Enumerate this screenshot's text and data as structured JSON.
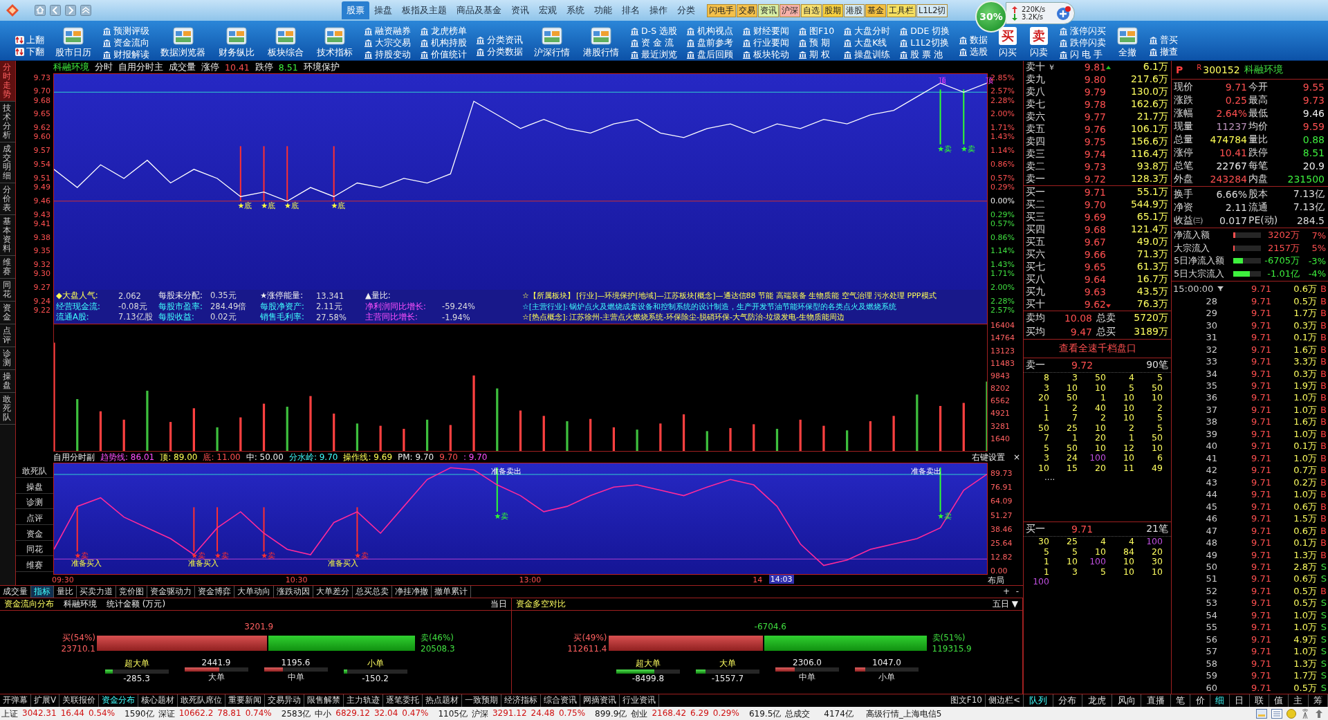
{
  "top_bar": {
    "menu": [
      {
        "label": "股票",
        "selected": true
      },
      {
        "label": "操盘",
        "selected": false
      },
      {
        "label": "板指及主题",
        "selected": false
      },
      {
        "label": "商品及基金",
        "selected": false
      },
      {
        "label": "资讯",
        "selected": false
      },
      {
        "label": "宏观",
        "selected": false
      },
      {
        "label": "系统",
        "selected": false
      },
      {
        "label": "功能",
        "selected": false
      },
      {
        "label": "排名",
        "selected": false
      },
      {
        "label": "操作",
        "selected": false
      },
      {
        "label": "分类",
        "selected": false
      }
    ],
    "tags": [
      {
        "label": "闪电手",
        "color": "#f4c04a"
      },
      {
        "label": "交易",
        "color": "#f4c04a"
      },
      {
        "label": "资讯",
        "color": "#d6eea4"
      },
      {
        "label": "沪深",
        "color": "#f6b0a8"
      },
      {
        "label": "自选",
        "color": "#f6e070"
      },
      {
        "label": "股期",
        "color": "#f6d040"
      },
      {
        "label": "港股",
        "color": "#d4e8f0"
      },
      {
        "label": "基金",
        "color": "#f4c040"
      },
      {
        "label": "工具栏",
        "color": "#f6e060"
      },
      {
        "label": "L1L2切",
        "color": "#d4e8f4"
      }
    ],
    "speed": {
      "percent": "30%",
      "up": "220K/s",
      "down": "3.2K/s"
    }
  },
  "toolbar": [
    {
      "kind": "pager",
      "items": [
        "上翻",
        "下翻"
      ]
    },
    {
      "kind": "big",
      "items": [
        "股市日历"
      ]
    },
    {
      "kind": "list",
      "items": [
        "预测评级",
        "资金流向",
        "财报解读"
      ]
    },
    {
      "kind": "big",
      "items": [
        "数据浏览器"
      ]
    },
    {
      "kind": "big",
      "items": [
        "财务纵比"
      ]
    },
    {
      "kind": "big",
      "items": [
        "板块综合"
      ]
    },
    {
      "kind": "big",
      "items": [
        "技术指标"
      ]
    },
    {
      "kind": "list",
      "items": [
        "融资融券",
        "大宗交易",
        "持股变动"
      ]
    },
    {
      "kind": "list",
      "items": [
        "龙虎榜单",
        "机构持股",
        "价值统计"
      ]
    },
    {
      "kind": "list",
      "items": [
        "分类资讯",
        "分类数据"
      ]
    },
    {
      "kind": "big",
      "items": [
        "沪深行情"
      ]
    },
    {
      "kind": "big",
      "items": [
        "港股行情"
      ]
    },
    {
      "kind": "list",
      "items": [
        "D-S 选股",
        "资 金 流",
        "最近浏览"
      ]
    },
    {
      "kind": "list",
      "items": [
        "机构视点",
        "盘前参考",
        "盘后回顾"
      ]
    },
    {
      "kind": "list",
      "items": [
        "财经要闻",
        "行业要闻",
        "板块轮动"
      ]
    },
    {
      "kind": "list",
      "items": [
        "图F10",
        "预 期",
        "期 权"
      ]
    },
    {
      "kind": "list",
      "items": [
        "大盘分时",
        "大盘K线",
        "操盘训练"
      ]
    },
    {
      "kind": "list",
      "items": [
        "DDE 切换",
        "L1L2切换",
        "股 票 池"
      ]
    },
    {
      "kind": "list",
      "items": [
        "数据",
        "选股"
      ]
    },
    {
      "kind": "big",
      "items": [
        "闪买"
      ],
      "badge": "买"
    },
    {
      "kind": "big",
      "items": [
        "闪卖"
      ],
      "badge": "卖"
    },
    {
      "kind": "list",
      "items": [
        "涨停闪买",
        "跌停闪卖",
        "闪 电 手"
      ]
    },
    {
      "kind": "big",
      "items": [
        "全撤"
      ]
    },
    {
      "kind": "list",
      "items": [
        "普买",
        "撤查"
      ]
    }
  ],
  "side_tabs": [
    {
      "label": "分时走势",
      "selected": true
    },
    {
      "label": "技术分析",
      "selected": false
    },
    {
      "label": "成交明细",
      "selected": false
    },
    {
      "label": "分价表",
      "selected": false
    },
    {
      "label": "基本资料",
      "selected": false
    },
    {
      "label": "维赛",
      "selected": false
    },
    {
      "label": "同花",
      "selected": false
    },
    {
      "label": "资金",
      "selected": false
    },
    {
      "label": "点评",
      "selected": false
    },
    {
      "label": "诊测",
      "selected": false
    },
    {
      "label": "操盘",
      "selected": false
    },
    {
      "label": "敢死队",
      "selected": false
    }
  ],
  "price_chart": {
    "header": [
      {
        "text": "科融环境",
        "kind": "stock"
      },
      {
        "text": "分时",
        "kind": "text"
      },
      {
        "text": "自用分时主",
        "kind": "text"
      },
      {
        "text": "成交量",
        "kind": "text"
      },
      {
        "text": "涨停",
        "kind": "text"
      },
      {
        "text": "10.41",
        "kind": "up"
      },
      {
        "text": "跌停",
        "kind": "text"
      },
      {
        "text": "8.51",
        "kind": "down"
      },
      {
        "text": "环境保护",
        "kind": "text"
      }
    ],
    "right_ticks": [
      "2.85%",
      "2.57%",
      "2.28%",
      "2.00%",
      "1.71%",
      "1.43%",
      "1.14%",
      "0.86%",
      "0.57%",
      "0.29%",
      "0.00%",
      "0.29%",
      "0.57%",
      "0.86%",
      "1.14%",
      "1.43%",
      "1.71%",
      "2.00%",
      "2.28%",
      "2.57%"
    ],
    "chart_data": {
      "type": "line",
      "ylim": [
        9.19,
        9.74
      ],
      "categories": [
        null,
        null,
        null,
        null,
        null,
        null,
        null,
        null,
        null,
        null,
        null,
        null,
        null,
        null,
        null,
        null,
        null,
        null,
        null,
        null,
        null,
        null,
        null,
        null,
        null,
        null,
        null,
        null,
        null,
        null,
        null,
        null,
        null,
        null,
        null,
        null,
        null,
        null,
        null,
        null,
        null
      ],
      "values": [
        9.53,
        9.49,
        9.54,
        9.51,
        9.55,
        9.5,
        9.53,
        9.51,
        9.47,
        9.48,
        9.46,
        9.49,
        9.47,
        9.5,
        9.49,
        9.51,
        9.5,
        9.52,
        9.68,
        9.65,
        9.62,
        9.64,
        9.62,
        9.61,
        9.63,
        9.64,
        9.61,
        9.6,
        9.62,
        9.63,
        9.61,
        9.63,
        9.62,
        9.64,
        9.63,
        9.65,
        9.66,
        9.69,
        9.72,
        9.7,
        9.72
      ],
      "yticks": [
        {
          "value": 9.73,
          "label": "9.73"
        },
        {
          "value": 9.7,
          "label": "9.70"
        },
        {
          "value": 9.68,
          "label": "9.68"
        },
        {
          "value": 9.65,
          "label": "9.65"
        },
        {
          "value": 9.62,
          "label": "9.62"
        },
        {
          "value": 9.6,
          "label": "9.60"
        },
        {
          "value": 9.57,
          "label": "9.57"
        },
        {
          "value": 9.54,
          "label": "9.54"
        },
        {
          "value": 9.51,
          "label": "9.51"
        },
        {
          "value": 9.49,
          "label": "9.49"
        },
        {
          "value": 9.46,
          "label": "9.46"
        },
        {
          "value": 9.43,
          "label": "9.43"
        },
        {
          "value": 9.41,
          "label": "9.41"
        },
        {
          "value": 9.38,
          "label": "9.38"
        },
        {
          "value": 9.35,
          "label": "9.35"
        },
        {
          "value": 9.32,
          "label": "9.32"
        },
        {
          "value": 9.3,
          "label": "9.30"
        },
        {
          "value": 9.27,
          "label": "9.27"
        },
        {
          "value": 9.24,
          "label": "9.24"
        },
        {
          "value": 9.22,
          "label": "9.22"
        }
      ],
      "ref_lines": [
        {
          "axis": "y",
          "value": 9.7,
          "color": "#30d0d0"
        },
        {
          "axis": "y",
          "value": 9.46,
          "color": "#d03030"
        }
      ],
      "annotations": [
        "★底",
        "★底",
        "★底",
        "★底",
        "★卖",
        "★卖",
        "顶",
        "顶"
      ]
    }
  },
  "info_band": [
    {
      "items": [
        {
          "label": "◆大盘人气:",
          "value": "2.062",
          "kind": "highlight"
        },
        {
          "label": "每股未分配:",
          "value": "0.35元",
          "kind": "plain"
        },
        {
          "label": "★涨停能量:",
          "value": "13.341",
          "kind": "plain"
        },
        {
          "label": "▲量比:",
          "kind": "plain"
        }
      ],
      "note": {
        "label": "☆【所属板块】",
        "text": "[行业]—环境保护[地域]—江苏板块[概念]—通达信88 节能 高端装备 生物质能 空气治理 污水处理 PPP模式",
        "kind": "sector"
      }
    },
    {
      "items": [
        {
          "label": "经营现金流:",
          "value": "-0.08元",
          "kind": "main"
        },
        {
          "label": "每股市盈率:",
          "value": "284.49倍",
          "kind": "main"
        },
        {
          "label": "每股净资产:",
          "value": "2.11元",
          "kind": "main"
        },
        {
          "label": "净利润同比增长:",
          "value": "-59.24%",
          "kind": "growth"
        }
      ],
      "note": {
        "label": "☆[主营行业]:",
        "text": "锅炉点火及燃烧成套设备和控制系统的设计制造，生产开发节油节能环保型的各类点火及燃烧系统",
        "kind": "business"
      }
    },
    {
      "items": [
        {
          "label": "流通A股:",
          "value": "7.13亿股",
          "kind": "main"
        },
        {
          "label": "每股收益:",
          "value": "0.02元",
          "kind": "main"
        },
        {
          "label": "销售毛利率:",
          "value": "27.58%",
          "kind": "main"
        },
        {
          "label": "主营同比增长:",
          "value": "-1.94%",
          "kind": "growth"
        }
      ],
      "note": {
        "label": "☆[热点概念]:",
        "text": "江苏徐州-主营点火燃烧系统-环保除尘-脱硝环保-大气防治-垃圾发电-生物质能周边",
        "kind": "concept"
      }
    }
  ],
  "volume_chart": {
    "chart_data": {
      "type": "bar",
      "ylim": [
        0,
        16600
      ],
      "categories": [
        null,
        null,
        null,
        null,
        null,
        null,
        null,
        null,
        null,
        null,
        null,
        null,
        null,
        null,
        null,
        null,
        null,
        null,
        null,
        null,
        null,
        null,
        null,
        null,
        null,
        null,
        null,
        null,
        null,
        null,
        null,
        null,
        null,
        null,
        null,
        null,
        null,
        null,
        null,
        null,
        null
      ],
      "values": [
        14200,
        6800,
        5200,
        4100,
        7900,
        3800,
        5600,
        3100,
        4400,
        6200,
        5800,
        7200,
        4900,
        3600,
        3300,
        2900,
        4100,
        3400,
        9900,
        8200,
        5300,
        4600,
        3900,
        4200,
        3100,
        2800,
        3600,
        4800,
        2600,
        3000,
        3500,
        2900,
        4100,
        3300,
        2700,
        3900,
        4600,
        7400,
        5900,
        6300,
        9100
      ],
      "yticks": [
        {
          "value": 16404,
          "label": "16404"
        },
        {
          "value": 14764,
          "label": "14764"
        },
        {
          "value": 13123,
          "label": "13123"
        },
        {
          "value": 11483,
          "label": "11483"
        },
        {
          "value": 9843,
          "label": "9843"
        },
        {
          "value": 8202,
          "label": "8202"
        },
        {
          "value": 6562,
          "label": "6562"
        },
        {
          "value": 4921,
          "label": "4921"
        },
        {
          "value": 3281,
          "label": "3281"
        },
        {
          "value": 1640,
          "label": "1640"
        }
      ]
    }
  },
  "indicator": {
    "header": [
      {
        "text": "自用分时副",
        "kind": "name"
      },
      {
        "text": "趋势线: 86.01",
        "kind": "trend"
      },
      {
        "text": "顶: 89.00",
        "kind": "top"
      },
      {
        "text": "底: 11.00",
        "kind": "bottom"
      },
      {
        "text": "中: 50.00",
        "kind": "mid"
      },
      {
        "text": "分水岭: 9.70",
        "kind": "watershed"
      },
      {
        "text": "操作线: 9.69",
        "kind": "operate"
      },
      {
        "text": "PM: 9.70",
        "kind": "pm"
      },
      {
        "text": "9.70",
        "kind": "value"
      },
      {
        "text": ": 9.70",
        "kind": "ratio"
      }
    ],
    "settings": "右键设置",
    "close": "×",
    "side_buttons": [
      "敢死队",
      "操盘",
      "诊测",
      "点评",
      "资金",
      "同花",
      "维赛"
    ],
    "chart_data": {
      "type": "line",
      "ylim": [
        -3,
        100
      ],
      "categories": [
        null,
        null,
        null,
        null,
        null,
        null,
        null,
        null,
        null,
        null,
        null,
        null,
        null,
        null,
        null,
        null,
        null,
        null,
        null,
        null,
        null,
        null,
        null,
        null,
        null,
        null,
        null,
        null,
        null,
        null,
        null,
        null,
        null,
        null,
        null,
        null,
        null,
        null,
        null,
        null,
        null
      ],
      "values": [
        20,
        60,
        68,
        50,
        40,
        30,
        15,
        40,
        55,
        35,
        20,
        15,
        45,
        55,
        35,
        60,
        85,
        96,
        94,
        80,
        70,
        55,
        60,
        70,
        78,
        80,
        75,
        70,
        78,
        85,
        80,
        60,
        25,
        5,
        10,
        20,
        25,
        30,
        40,
        75,
        90
      ],
      "yticks": [
        {
          "value": 89.73,
          "label": "89.73"
        },
        {
          "value": 76.91,
          "label": "76.91"
        },
        {
          "value": 64.09,
          "label": "64.09"
        },
        {
          "value": 51.27,
          "label": "51.27"
        },
        {
          "value": 38.46,
          "label": "38.46"
        },
        {
          "value": 25.64,
          "label": "25.64"
        },
        {
          "value": 12.82,
          "label": "12.82"
        },
        {
          "value": 0,
          "label": "0.00"
        }
      ],
      "ref_lines": [
        {
          "axis": "y",
          "value": 89.73,
          "color": "#30d0d0"
        },
        {
          "axis": "y",
          "value": 11,
          "color": "#b040d0"
        }
      ],
      "annotations": [
        "准备买入",
        "准备买入",
        "准备买入",
        "准备卖出",
        "准备卖出",
        "★卖",
        "★卖",
        "★卖",
        "★卖",
        "★卖",
        "★卖",
        "★卖"
      ]
    }
  },
  "time_axis": {
    "labels": [
      "09:30",
      "10:30",
      "13:00",
      "14"
    ],
    "cursor": "14:03",
    "layout": "布局"
  },
  "chart_tabs": {
    "tabs": [
      {
        "label": "成交量",
        "selected": false
      },
      {
        "label": "指标",
        "selected": true
      },
      {
        "label": "量比",
        "selected": false
      },
      {
        "label": "买卖力道",
        "selected": false
      },
      {
        "label": "竞价图",
        "selected": false
      },
      {
        "label": "资金驱动力",
        "selected": false
      },
      {
        "label": "资金博弈",
        "selected": false
      },
      {
        "label": "大单动向",
        "selected": false
      },
      {
        "label": "涨跌动因",
        "selected": false
      },
      {
        "label": "大单差分",
        "selected": false
      },
      {
        "label": "总买总卖",
        "selected": false
      },
      {
        "label": "净挂净撤",
        "selected": false
      },
      {
        "label": "撤单累计",
        "selected": false
      }
    ],
    "buttons": [
      "+",
      "-"
    ]
  },
  "fund_panels": [
    {
      "title": "资金流向分布",
      "subtitle": "科融环境",
      "unit": "统计金额 (万元)",
      "period": "当日",
      "net": "3201.9",
      "buy_label": "买(54%)",
      "buy_value": "23710.1",
      "sell_label": "卖(46%)",
      "sell_value": "20508.3",
      "level": 0.54,
      "orders": [
        {
          "label": "超大单",
          "value": "-285.3",
          "kind": "outflow",
          "level": 0.12
        },
        {
          "label": "大单",
          "value": "2441.9",
          "kind": "inflow",
          "level": 0.55
        },
        {
          "label": "中单",
          "value": "1195.6",
          "kind": "inflow",
          "level": 0.3
        },
        {
          "label": "小单",
          "value": "-150.2",
          "kind": "outflow",
          "level": 0.06
        }
      ]
    },
    {
      "title": "资金多空对比",
      "period": "五日",
      "dropdown": "▼",
      "net": "-6704.6",
      "buy_label": "买(49%)",
      "buy_value": "112611.4",
      "sell_label": "卖(51%)",
      "sell_value": "119315.9",
      "level": 0.49,
      "orders": [
        {
          "label": "超大单",
          "value": "-8499.8",
          "kind": "outflow",
          "level": 0.6
        },
        {
          "label": "大单",
          "value": "-1557.7",
          "kind": "outflow",
          "level": 0.15
        },
        {
          "label": "中单",
          "value": "2306.0",
          "kind": "inflow",
          "level": 0.3
        },
        {
          "label": "小单",
          "value": "1047.0",
          "kind": "inflow",
          "level": 0.16
        }
      ]
    }
  ],
  "order_book": {
    "sells": [
      {
        "label": "卖十",
        "note": "￥",
        "price": "9.81",
        "volume": "6.1万"
      },
      {
        "label": "卖九",
        "price": "9.80",
        "volume": "217.6万"
      },
      {
        "label": "卖八",
        "price": "9.79",
        "volume": "130.0万"
      },
      {
        "label": "卖七",
        "price": "9.78",
        "volume": "162.6万"
      },
      {
        "label": "卖六",
        "price": "9.77",
        "volume": "21.7万"
      },
      {
        "label": "卖五",
        "price": "9.76",
        "volume": "106.1万"
      },
      {
        "label": "卖四",
        "price": "9.75",
        "volume": "156.6万"
      },
      {
        "label": "卖三",
        "price": "9.74",
        "volume": "116.4万"
      },
      {
        "label": "卖二",
        "price": "9.73",
        "volume": "93.8万"
      },
      {
        "label": "卖一",
        "price": "9.72",
        "volume": "128.3万"
      }
    ],
    "buys": [
      {
        "label": "买一",
        "price": "9.71",
        "volume": "55.1万"
      },
      {
        "label": "买二",
        "price": "9.70",
        "volume": "544.9万"
      },
      {
        "label": "买三",
        "price": "9.69",
        "volume": "65.1万"
      },
      {
        "label": "买四",
        "price": "9.68",
        "volume": "121.4万"
      },
      {
        "label": "买五",
        "price": "9.67",
        "volume": "49.0万"
      },
      {
        "label": "买六",
        "price": "9.66",
        "volume": "71.3万"
      },
      {
        "label": "买七",
        "price": "9.65",
        "volume": "61.3万"
      },
      {
        "label": "买八",
        "price": "9.64",
        "volume": "16.7万"
      },
      {
        "label": "买九",
        "price": "9.63",
        "volume": "43.5万"
      },
      {
        "label": "买十",
        "price": "9.62",
        "volume": "76.3万"
      }
    ],
    "averages": [
      {
        "label": "卖均",
        "price": "10.08",
        "total_label": "总卖",
        "total": "5720万"
      },
      {
        "label": "买均",
        "price": "9.47",
        "total_label": "总买",
        "total": "3189万"
      }
    ],
    "depth_button": "查看全速千档盘口",
    "queues": [
      {
        "label": "卖一",
        "price": "9.72",
        "count": "90笔",
        "more": "....",
        "rows": [
          {
            "cells": [
              "8",
              "3",
              "50",
              "4",
              "5"
            ],
            "large": [
              false,
              false,
              false,
              false,
              false
            ]
          },
          {
            "cells": [
              "3",
              "10",
              "10",
              "5",
              "50"
            ],
            "large": [
              false,
              false,
              false,
              false,
              false
            ]
          },
          {
            "cells": [
              "20",
              "50",
              "1",
              "10",
              "10"
            ],
            "large": [
              false,
              false,
              false,
              false,
              false
            ]
          },
          {
            "cells": [
              "1",
              "2",
              "40",
              "10",
              "2"
            ],
            "large": [
              false,
              false,
              false,
              false,
              false
            ]
          },
          {
            "cells": [
              "1",
              "7",
              "2",
              "10",
              "5"
            ],
            "large": [
              false,
              false,
              false,
              false,
              false
            ]
          },
          {
            "cells": [
              "50",
              "25",
              "10",
              "2",
              "5"
            ],
            "large": [
              false,
              false,
              false,
              false,
              false
            ]
          },
          {
            "cells": [
              "7",
              "1",
              "20",
              "1",
              "50"
            ],
            "large": [
              false,
              false,
              false,
              false,
              false
            ]
          },
          {
            "cells": [
              "5",
              "50",
              "10",
              "12",
              "10"
            ],
            "large": [
              false,
              false,
              false,
              false,
              false
            ]
          },
          {
            "cells": [
              "3",
              "24",
              "100",
              "10",
              "6"
            ],
            "large": [
              false,
              false,
              true,
              false,
              false
            ]
          },
          {
            "cells": [
              "10",
              "15",
              "20",
              "11",
              "49"
            ],
            "large": [
              false,
              false,
              false,
              false,
              false
            ]
          }
        ]
      },
      {
        "label": "买一",
        "price": "9.71",
        "count": "21笔",
        "rows": [
          {
            "cells": [
              "30",
              "25",
              "4",
              "4",
              "100"
            ],
            "large": [
              false,
              false,
              false,
              false,
              true
            ]
          },
          {
            "cells": [
              "5",
              "5",
              "10",
              "84",
              "20"
            ],
            "large": [
              false,
              false,
              false,
              false,
              false
            ]
          },
          {
            "cells": [
              "1",
              "10",
              "100",
              "10",
              "30"
            ],
            "large": [
              false,
              false,
              true,
              false,
              false
            ]
          },
          {
            "cells": [
              "1",
              "3",
              "5",
              "10",
              "10"
            ],
            "large": [
              false,
              false,
              false,
              false,
              false
            ]
          },
          {
            "cells": [
              "100"
            ],
            "large": [
              true
            ]
          }
        ]
      }
    ]
  },
  "quote": {
    "flag": "P",
    "mark": "R",
    "code": "300152",
    "name": "科融环境",
    "main": [
      [
        {
          "label": "现价",
          "value": "9.71",
          "kind": "up"
        },
        {
          "label": "今开",
          "value": "9.55",
          "kind": "up"
        }
      ],
      [
        {
          "label": "涨跌",
          "value": "0.25",
          "kind": "up"
        },
        {
          "label": "最高",
          "value": "9.73",
          "kind": "up"
        }
      ],
      [
        {
          "label": "涨幅",
          "value": "2.64%",
          "kind": "up"
        },
        {
          "label": "最低",
          "value": "9.46",
          "kind": "flat"
        }
      ],
      [
        {
          "label": "现量",
          "value": "11237",
          "kind": "current"
        },
        {
          "label": "均价",
          "value": "9.59",
          "kind": "up"
        }
      ],
      [
        {
          "label": "总量",
          "value": "474784",
          "kind": "volume"
        },
        {
          "label": "量比",
          "value": "0.88",
          "kind": "down"
        }
      ],
      [
        {
          "label": "涨停",
          "value": "10.41",
          "kind": "up"
        },
        {
          "label": "跌停",
          "value": "8.51",
          "kind": "down"
        }
      ],
      [
        {
          "label": "总笔",
          "value": "22767",
          "kind": "flat"
        },
        {
          "label": "每笔",
          "value": "20.9",
          "kind": "flat"
        }
      ],
      [
        {
          "label": "外盘",
          "value": "243284",
          "kind": "up"
        },
        {
          "label": "内盘",
          "value": "231500",
          "kind": "down"
        }
      ]
    ],
    "extra": [
      [
        {
          "label": "换手",
          "value": "6.66%"
        },
        {
          "label": "股本",
          "value": "7.13亿"
        }
      ],
      [
        {
          "label": "净资",
          "value": "2.11"
        },
        {
          "label": "流通",
          "value": "7.13亿"
        }
      ],
      [
        {
          "label": "收益㈢",
          "value": "0.017"
        },
        {
          "label": "PE(动)",
          "value": "284.5"
        }
      ]
    ],
    "flows": [
      {
        "label": "净流入额",
        "value": "3202万",
        "pct": "7%",
        "kind": "inflow",
        "level": 0.07
      },
      {
        "label": "大宗流入",
        "value": "2157万",
        "pct": "5%",
        "kind": "inflow",
        "level": 0.05
      },
      {
        "label": "5日净流入额",
        "value": "-6705万",
        "pct": "-3%",
        "kind": "outflow",
        "level": 0.35
      },
      {
        "label": "5日大宗流入",
        "value": "-1.01亿",
        "pct": "-4%",
        "kind": "outflow",
        "level": 0.6
      }
    ]
  },
  "ticks": [
    {
      "time": "15:00:00",
      "price": "9.71",
      "volume": "0.6万",
      "side": "B",
      "kind": "buy"
    },
    {
      "time": "28",
      "price": "9.71",
      "volume": "0.5万",
      "side": "B",
      "kind": "buy"
    },
    {
      "time": "29",
      "price": "9.71",
      "volume": "1.7万",
      "side": "B",
      "kind": "buy"
    },
    {
      "time": "30",
      "price": "9.71",
      "volume": "0.3万",
      "side": "B",
      "kind": "buy"
    },
    {
      "time": "31",
      "price": "9.71",
      "volume": "0.1万",
      "side": "B",
      "kind": "buy"
    },
    {
      "time": "32",
      "price": "9.71",
      "volume": "1.6万",
      "side": "B",
      "kind": "buy"
    },
    {
      "time": "33",
      "price": "9.71",
      "volume": "3.3万",
      "side": "B",
      "kind": "buy"
    },
    {
      "time": "34",
      "price": "9.71",
      "volume": "0.3万",
      "side": "B",
      "kind": "buy"
    },
    {
      "time": "35",
      "price": "9.71",
      "volume": "1.9万",
      "side": "B",
      "kind": "buy"
    },
    {
      "time": "36",
      "price": "9.71",
      "volume": "1.0万",
      "side": "B",
      "kind": "buy"
    },
    {
      "time": "37",
      "price": "9.71",
      "volume": "1.0万",
      "side": "B",
      "kind": "buy"
    },
    {
      "time": "38",
      "price": "9.71",
      "volume": "1.6万",
      "side": "B",
      "kind": "buy"
    },
    {
      "time": "39",
      "price": "9.71",
      "volume": "1.0万",
      "side": "B",
      "kind": "buy"
    },
    {
      "time": "40",
      "price": "9.71",
      "volume": "0.1万",
      "side": "B",
      "kind": "buy"
    },
    {
      "time": "41",
      "price": "9.71",
      "volume": "1.0万",
      "side": "B",
      "kind": "buy"
    },
    {
      "time": "42",
      "price": "9.71",
      "volume": "0.7万",
      "side": "B",
      "kind": "buy"
    },
    {
      "time": "43",
      "price": "9.71",
      "volume": "0.2万",
      "side": "B",
      "kind": "buy"
    },
    {
      "time": "44",
      "price": "9.71",
      "volume": "1.0万",
      "side": "B",
      "kind": "buy"
    },
    {
      "time": "45",
      "price": "9.71",
      "volume": "0.6万",
      "side": "B",
      "kind": "buy"
    },
    {
      "time": "46",
      "price": "9.71",
      "volume": "1.5万",
      "side": "B",
      "kind": "buy"
    },
    {
      "time": "47",
      "price": "9.71",
      "volume": "0.6万",
      "side": "B",
      "kind": "buy"
    },
    {
      "time": "48",
      "price": "9.71",
      "volume": "0.1万",
      "side": "B",
      "kind": "buy"
    },
    {
      "time": "49",
      "price": "9.71",
      "volume": "1.3万",
      "side": "B",
      "kind": "buy"
    },
    {
      "time": "50",
      "price": "9.71",
      "volume": "2.8万",
      "side": "S",
      "kind": "sell"
    },
    {
      "time": "51",
      "price": "9.71",
      "volume": "0.6万",
      "side": "S",
      "kind": "sell"
    },
    {
      "time": "52",
      "price": "9.71",
      "volume": "0.5万",
      "side": "B",
      "kind": "buy"
    },
    {
      "time": "53",
      "price": "9.71",
      "volume": "0.5万",
      "side": "S",
      "kind": "sell"
    },
    {
      "time": "54",
      "price": "9.71",
      "volume": "1.0万",
      "side": "S",
      "kind": "sell"
    },
    {
      "time": "55",
      "price": "9.71",
      "volume": "1.0万",
      "side": "S",
      "kind": "sell"
    },
    {
      "time": "56",
      "price": "9.71",
      "volume": "4.9万",
      "side": "S",
      "kind": "sell"
    },
    {
      "time": "57",
      "price": "9.71",
      "volume": "1.0万",
      "side": "S",
      "kind": "sell"
    },
    {
      "time": "58",
      "price": "9.71",
      "volume": "1.3万",
      "side": "S",
      "kind": "sell"
    },
    {
      "time": "59",
      "price": "9.71",
      "volume": "1.7万",
      "side": "S",
      "kind": "sell"
    },
    {
      "time": "60",
      "price": "9.71",
      "volume": "0.5万",
      "side": "S",
      "kind": "sell"
    }
  ],
  "bottom_tabs": {
    "left": [
      {
        "label": "开弹幕",
        "selected": false
      },
      {
        "label": "扩展V",
        "selected": false
      },
      {
        "label": "关联报价",
        "selected": false
      },
      {
        "label": "资金分布",
        "selected": true
      },
      {
        "label": "核心题材",
        "selected": false
      },
      {
        "label": "敢死队席位",
        "selected": false
      },
      {
        "label": "重要新闻",
        "selected": false
      },
      {
        "label": "交易异动",
        "selected": false
      },
      {
        "label": "限售解禁",
        "selected": false
      },
      {
        "label": "主力轨迹",
        "selected": false
      },
      {
        "label": "逐笔委托",
        "selected": false
      },
      {
        "label": "热点题材",
        "selected": false
      },
      {
        "label": "一致预期",
        "selected": false
      },
      {
        "label": "经济指标",
        "selected": false
      },
      {
        "label": "综合资讯",
        "selected": false
      },
      {
        "label": "网摘资讯",
        "selected": false
      },
      {
        "label": "行业资讯",
        "selected": false
      }
    ],
    "left_right": [
      "图文F10",
      "侧边栏<"
    ],
    "book": [
      {
        "label": "队列",
        "selected": true
      },
      {
        "label": "分布",
        "selected": false
      },
      {
        "label": "龙虎",
        "selected": false
      },
      {
        "label": "风向",
        "selected": false
      },
      {
        "label": "直播",
        "selected": false
      }
    ],
    "quote": [
      {
        "label": "笔",
        "selected": false
      },
      {
        "label": "价",
        "selected": false
      },
      {
        "label": "细",
        "selected": true
      },
      {
        "label": "日",
        "selected": false
      },
      {
        "label": "联",
        "selected": false
      },
      {
        "label": "值",
        "selected": false
      },
      {
        "label": "主",
        "selected": false
      },
      {
        "label": "筹",
        "selected": false
      }
    ]
  },
  "status_bar": {
    "indices": [
      {
        "name": "上证",
        "value": "3042.31",
        "change": "16.44",
        "pct": "0.54%",
        "amount": "1590亿"
      },
      {
        "name": "深证",
        "value": "10662.2",
        "change": "78.81",
        "pct": "0.74%",
        "amount": "2583亿"
      },
      {
        "name": "中小",
        "value": "6829.12",
        "change": "32.04",
        "pct": "0.47%",
        "amount": "1105亿"
      },
      {
        "name": "沪深",
        "value": "3291.12",
        "change": "24.48",
        "pct": "0.75%",
        "amount": "899.9亿"
      },
      {
        "name": "创业",
        "value": "2168.42",
        "change": "6.29",
        "pct": "0.29%",
        "amount": "619.5亿"
      }
    ],
    "total_label": "总成交",
    "total": "4174亿",
    "server": "高级行情_上海电信5"
  }
}
